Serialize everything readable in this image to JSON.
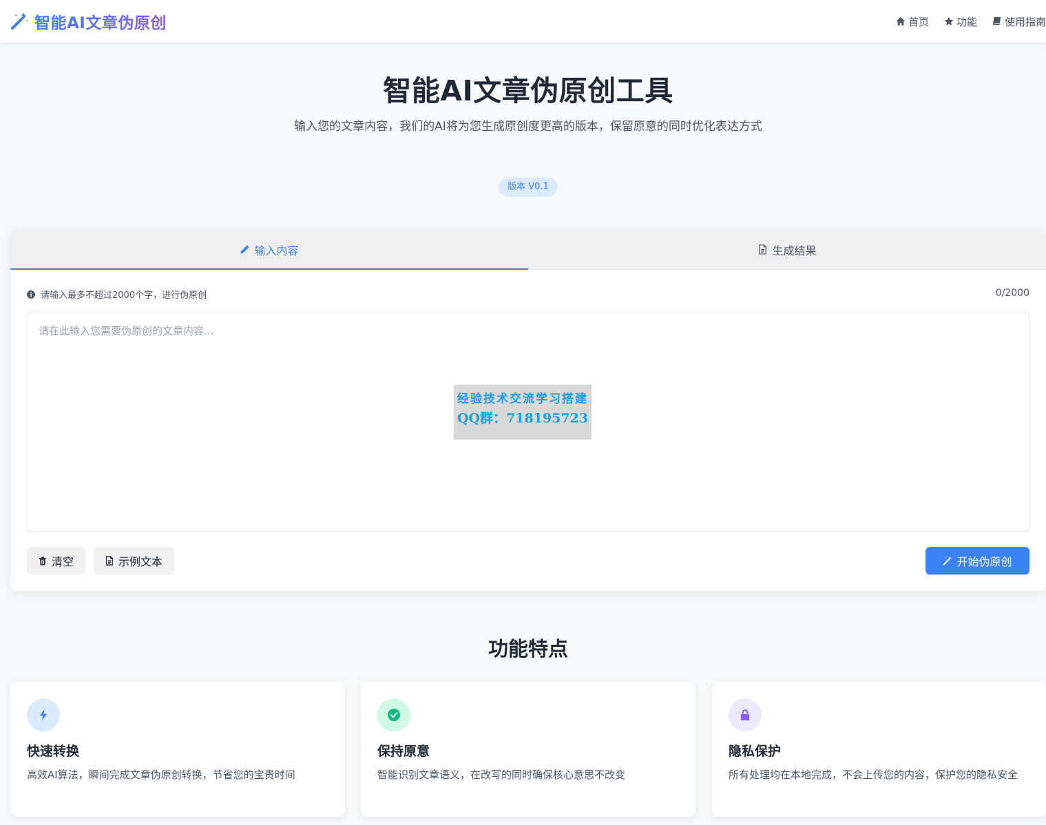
{
  "header": {
    "brand": "智能AI文章伪原创",
    "nav": [
      {
        "label": "首页",
        "icon": "home-icon"
      },
      {
        "label": "功能",
        "icon": "star-icon"
      },
      {
        "label": "使用指南",
        "icon": "book-icon"
      }
    ]
  },
  "hero": {
    "title": "智能AI文章伪原创工具",
    "description": "输入您的文章内容，我们的AI将为您生成原创度更高的版本，保留原意的同时优化表达方式",
    "version": "版本 V0.1"
  },
  "tabs": [
    {
      "label": "输入内容",
      "icon": "pencil-icon",
      "active": true
    },
    {
      "label": "生成结果",
      "icon": "document-icon",
      "active": false
    }
  ],
  "editor": {
    "hint": "请输入最多不超过2000个字，进行伪原创",
    "counter": "0/2000",
    "placeholder": "请在此输入您需要伪原创的文章内容...",
    "value": ""
  },
  "watermark": {
    "line1": "经验技术交流学习搭建",
    "line2": "QQ群：718195723"
  },
  "actions": {
    "clear": "清空",
    "sample": "示例文本",
    "start": "开始伪原创"
  },
  "features": {
    "title": "功能特点",
    "items": [
      {
        "title": "快速转换",
        "desc": "高效AI算法，瞬间完成文章伪原创转换，节省您的宝贵时间",
        "icon": "bolt-icon",
        "color": "#3b82f6",
        "bg": "#dbeafe"
      },
      {
        "title": "保持原意",
        "desc": "智能识别文章语义，在改写的同时确保核心意思不改变",
        "icon": "check-circle-icon",
        "color": "#10b981",
        "bg": "#d1fae5"
      },
      {
        "title": "隐私保护",
        "desc": "所有处理均在本地完成，不会上传您的内容，保护您的隐私安全",
        "icon": "lock-icon",
        "color": "#8b5cf6",
        "bg": "#ede9fe"
      }
    ]
  },
  "colors": {
    "accent": "#3b82f6",
    "brand_gradient_start": "#3b82f6",
    "brand_gradient_end": "#8b5cf6",
    "background": "#f8f9fb"
  }
}
